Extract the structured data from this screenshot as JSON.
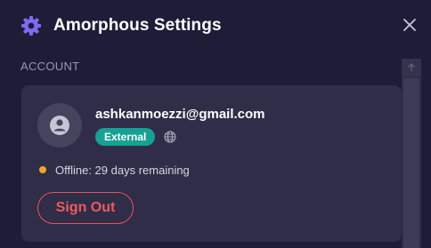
{
  "header": {
    "title": "Amorphous Settings",
    "icon": "gear-icon",
    "close_icon": "close-icon"
  },
  "section": {
    "label": "ACCOUNT"
  },
  "account": {
    "email": "ashkanmoezzi@gmail.com",
    "badge": "External",
    "status": "Offline: 29 days remaining",
    "sign_out_label": "Sign Out"
  },
  "colors": {
    "background": "#1e1c37",
    "card": "#2f2d47",
    "accent_purple": "#7b6cf2",
    "badge_teal": "#17a195",
    "status_amber": "#f5a623",
    "danger_red": "#ee5a62"
  }
}
